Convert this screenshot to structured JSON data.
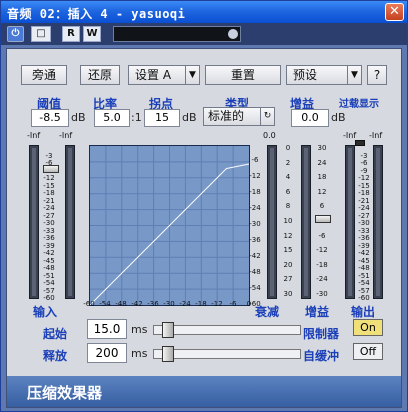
{
  "window": {
    "title": "音频 02：插入 4 - yasuoqi",
    "close_label": "✕"
  },
  "toolbar": {
    "power": "⏻",
    "ex": "□",
    "r": "R",
    "w": "W",
    "name_value": ""
  },
  "top_buttons": {
    "bypass": "旁通",
    "restore": "还原",
    "setting": "设置 A",
    "setting_arrow": "▼",
    "reset": "重置",
    "preset": "预设",
    "preset_arrow": "▼",
    "help": "?"
  },
  "params": {
    "threshold": {
      "label": "阈值",
      "value": "-8.5",
      "unit": "dB"
    },
    "ratio": {
      "label": "比率",
      "value": "5.0",
      "unit": ":1"
    },
    "knee": {
      "label": "拐点",
      "value": "15",
      "unit": "dB"
    },
    "type": {
      "label": "类型",
      "value": "标准的",
      "icon": "↻"
    },
    "gain": {
      "label": "增益",
      "value": "0.0",
      "unit": "dB"
    },
    "overload": {
      "label": "过载显示"
    }
  },
  "meters": {
    "in_header": [
      "-Inf",
      "-Inf"
    ],
    "in_label": "输入",
    "attn_header": "0.0",
    "attn_label": "衰减",
    "gain_label": "增益",
    "out_header": [
      "-Inf",
      "-Inf"
    ],
    "out_label": "输出",
    "scale_db": [
      "-0",
      "-3",
      "-6",
      "-9",
      "-12",
      "-15",
      "-18",
      "-21",
      "-24",
      "-27",
      "-30",
      "-33",
      "-36",
      "-39",
      "-42",
      "-45",
      "-48",
      "-51",
      "-54",
      "-57",
      "-60"
    ],
    "scale_in": [
      "-3",
      "-6",
      "-9",
      "-12",
      "-15",
      "-18",
      "-21",
      "-24",
      "-27",
      "-30",
      "-33",
      "-36",
      "-39",
      "-42",
      "-45",
      "-48",
      "-51",
      "-54",
      "-57",
      "-60"
    ],
    "scale_attn": [
      "0",
      "2",
      "4",
      "6",
      "8",
      "10",
      "12",
      "15",
      "20",
      "27",
      "30"
    ],
    "scale_gain": [
      "30",
      "24",
      "18",
      "12",
      "6",
      "0",
      "-6",
      "-12",
      "-18",
      "-24",
      "-30"
    ]
  },
  "graph": {
    "xlabels": [
      "-60",
      "-54",
      "-48",
      "-42",
      "-36",
      "-30",
      "-24",
      "-18",
      "-12",
      "-6",
      "0"
    ],
    "ylabels": [
      "-6",
      "-12",
      "-18",
      "-24",
      "-30",
      "-36",
      "-42",
      "-48",
      "-54",
      "-60"
    ],
    "threshold_db": -8.5,
    "ratio": 5.0
  },
  "timing": {
    "attack": {
      "label": "起始",
      "value": "15.0",
      "unit": "ms"
    },
    "release": {
      "label": "释放",
      "value": "200",
      "unit": "ms"
    },
    "limiter_label": "限制器",
    "limiter_state": "On",
    "autorelease_label": "自缓冲",
    "autorelease_state": "Off"
  },
  "footer": {
    "title": "压缩效果器"
  },
  "colors": {
    "accent": "#1a3fb8",
    "panel": "#d6d9df",
    "graph": "#7898c8"
  }
}
